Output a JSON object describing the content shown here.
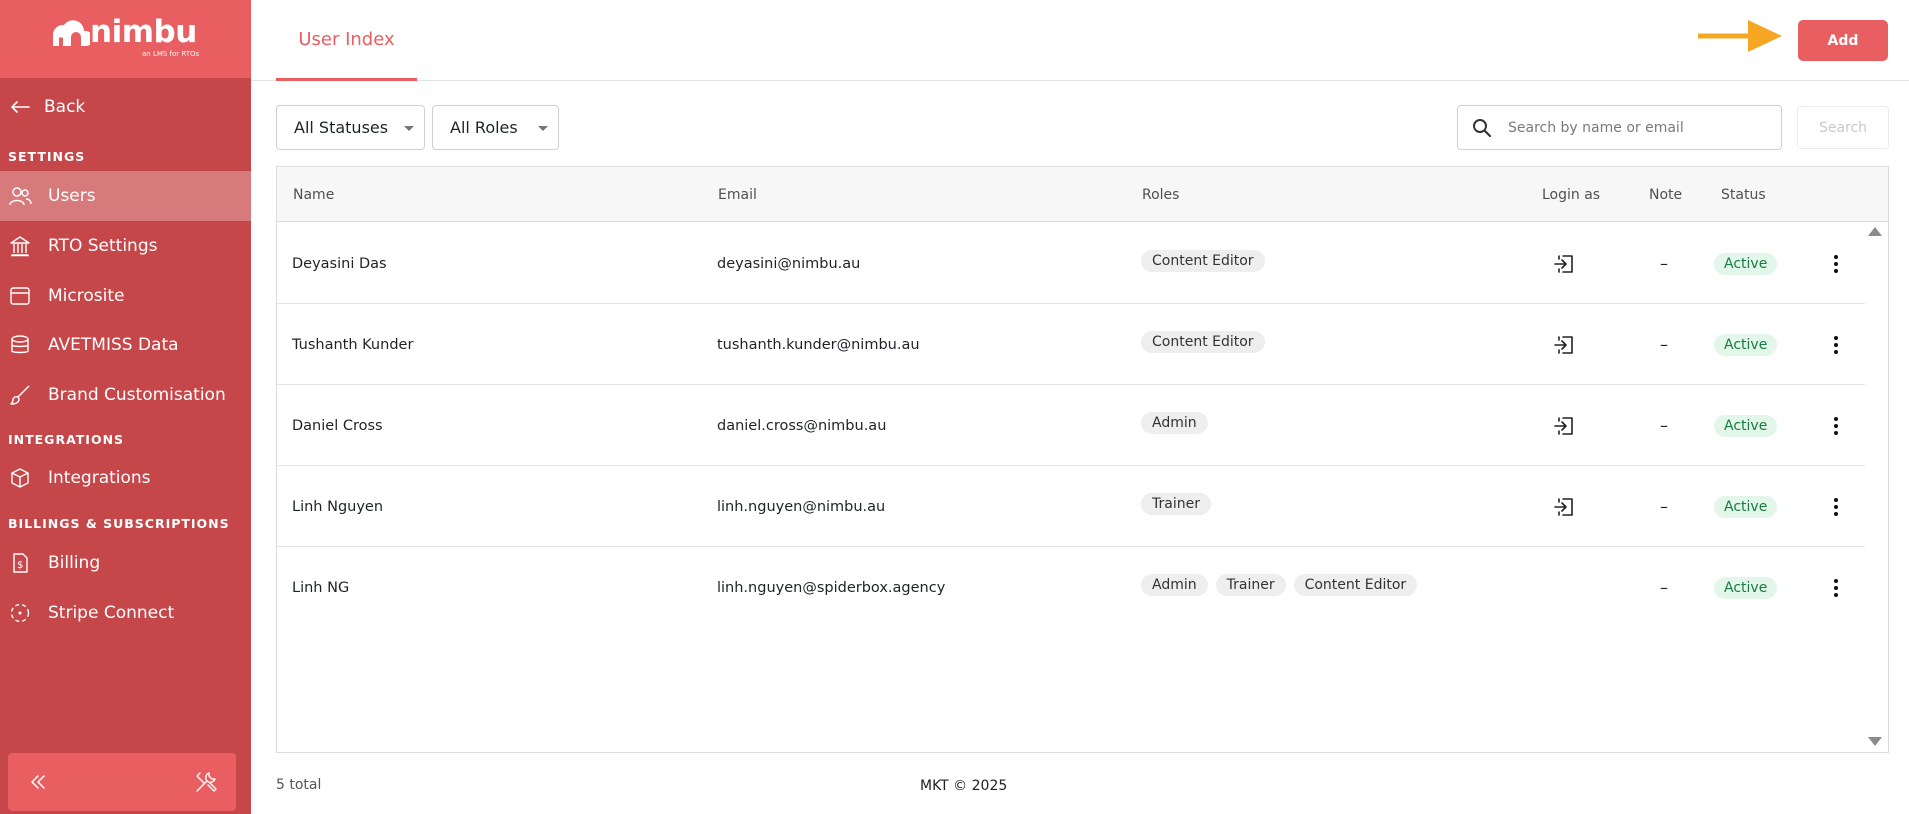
{
  "brand": {
    "name": "nimbu",
    "tagline": "an LMS for RTOs",
    "primary_color": "#e85e61",
    "sidebar_color": "#c5474a"
  },
  "sidebar": {
    "back_label": "Back",
    "sections": {
      "settings": "SETTINGS",
      "integrations": "INTEGRATIONS",
      "billings": "BILLINGS & SUBSCRIPTIONS"
    },
    "items": {
      "users": {
        "label": "Users",
        "icon": "users-icon",
        "active": true
      },
      "rto_settings": {
        "label": "RTO Settings",
        "icon": "building-icon"
      },
      "microsite": {
        "label": "Microsite",
        "icon": "browser-window-icon"
      },
      "avetmiss": {
        "label": "AVETMISS Data",
        "icon": "database-icon"
      },
      "brand": {
        "label": "Brand Customisation",
        "icon": "paintbrush-icon"
      },
      "integrations": {
        "label": "Integrations",
        "icon": "cube-icon"
      },
      "billing": {
        "label": "Billing",
        "icon": "invoice-dollar-icon"
      },
      "stripe": {
        "label": "Stripe Connect",
        "icon": "dashed-circle-icon"
      }
    }
  },
  "header": {
    "tab_label": "User Index",
    "add_label": "Add"
  },
  "filters": {
    "status": "All Statuses",
    "roles": "All Roles",
    "search_placeholder": "Search by name or email",
    "search_button": "Search"
  },
  "table": {
    "columns": {
      "name": "Name",
      "email": "Email",
      "roles": "Roles",
      "login": "Login as",
      "note": "Note",
      "status": "Status"
    },
    "rows": [
      {
        "name": "Deyasini Das",
        "email": "deyasini@nimbu.au",
        "roles": [
          "Content Editor"
        ],
        "note": "–",
        "status": "Active"
      },
      {
        "name": "Tushanth Kunder",
        "email": "tushanth.kunder@nimbu.au",
        "roles": [
          "Content Editor"
        ],
        "note": "–",
        "status": "Active"
      },
      {
        "name": "Daniel Cross",
        "email": "daniel.cross@nimbu.au",
        "roles": [
          "Admin"
        ],
        "note": "–",
        "status": "Active"
      },
      {
        "name": "Linh Nguyen",
        "email": "linh.nguyen@nimbu.au",
        "roles": [
          "Trainer"
        ],
        "note": "–",
        "status": "Active"
      },
      {
        "name": "Linh NG",
        "email": "linh.nguyen@spiderbox.agency",
        "roles": [
          "Admin",
          "Trainer",
          "Content Editor"
        ],
        "note": "–",
        "status": "Active"
      }
    ]
  },
  "footer": {
    "total": "5 total",
    "copyright": "MKT © 2025"
  }
}
